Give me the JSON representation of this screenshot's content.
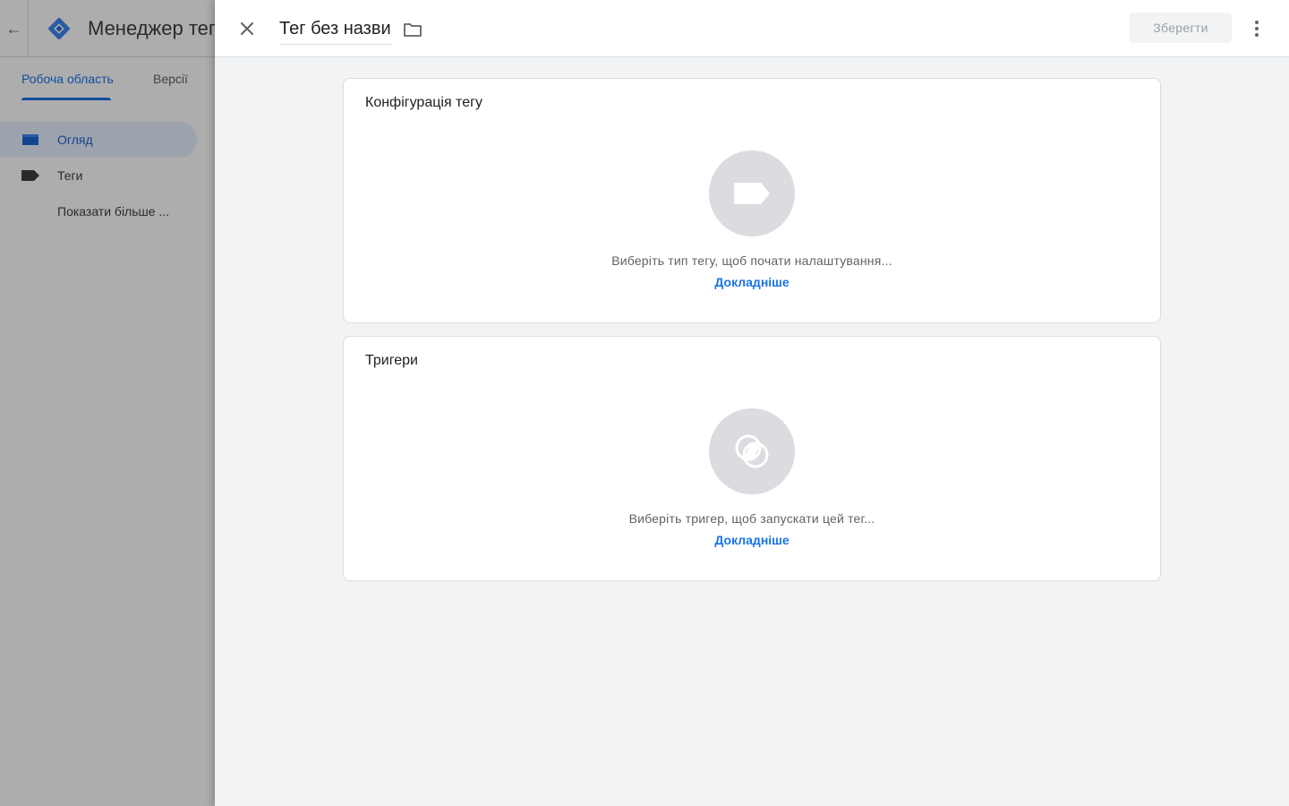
{
  "background_app": {
    "title": "Менеджер тегів",
    "tabs": [
      {
        "label": "Робоча область",
        "active": true
      },
      {
        "label": "Версії",
        "active": false
      }
    ],
    "nav": [
      {
        "label": "Огляд",
        "icon": "folder-icon",
        "active": true
      },
      {
        "label": "Теги",
        "icon": "tag-icon",
        "active": false
      },
      {
        "label": "Показати більше ...",
        "icon": "",
        "active": false
      }
    ]
  },
  "sheet": {
    "title": "Тег без назви",
    "save_label": "Зберегти",
    "save_enabled": false,
    "icons": {
      "close": "close-icon",
      "folder": "folder-icon",
      "more": "more-vert-icon"
    }
  },
  "cards": {
    "config": {
      "title": "Конфігурація тегу",
      "icon": "tag-icon",
      "hint": "Виберіть тип тегу, щоб почати налаштування...",
      "link": "Докладніше"
    },
    "triggers": {
      "title": "Тригери",
      "icon": "trigger-icon",
      "hint": "Виберіть тригер, щоб запускати цей тег...",
      "link": "Докладніше"
    }
  },
  "colors": {
    "accent": "#1a73e8",
    "icon_circle": "#dadce0",
    "sheet_bg": "#f1f3f4"
  }
}
